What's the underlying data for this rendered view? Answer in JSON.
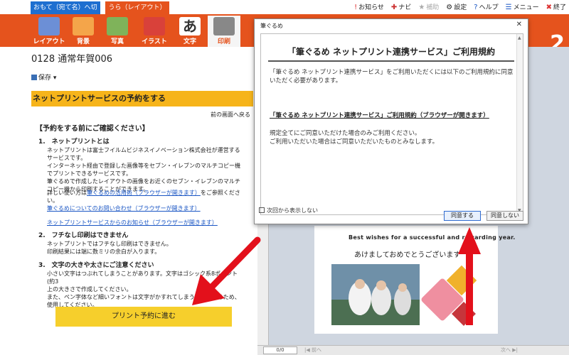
{
  "tabs": {
    "front_label": "おもて（宛て名）へ切替",
    "back_label": "うら（レイアウト）"
  },
  "topmenu": [
    {
      "icon": "!",
      "label": "お知らせ"
    },
    {
      "icon": "✚",
      "label": "ナビ"
    },
    {
      "icon": "★",
      "label": "補助"
    },
    {
      "icon": "⚙",
      "label": "設定"
    },
    {
      "icon": "?",
      "label": "ヘルプ"
    },
    {
      "icon": "☰",
      "label": "メニュー"
    },
    {
      "icon": "✖",
      "label": "終了"
    }
  ],
  "toolbar": {
    "items": [
      {
        "label": "レイアウト",
        "icon": "layout-icon",
        "color": "#6c8fd6"
      },
      {
        "label": "背景",
        "icon": "background-icon",
        "color": "#f4a54a"
      },
      {
        "label": "写真",
        "icon": "photo-icon",
        "color": "#7fb35a"
      },
      {
        "label": "イラスト",
        "icon": "illustration-icon",
        "color": "#d9413a"
      },
      {
        "label": "文字",
        "icon": "text-icon",
        "color": "#333333"
      },
      {
        "label": "印刷",
        "icon": "print-icon",
        "color": "#888888"
      }
    ],
    "big_number": "2"
  },
  "document": {
    "name": "0128 通常年賀006",
    "save_label": "保存"
  },
  "left_panel": {
    "section_title": "ネットプリントサービスの予約をする",
    "back_link": "前の画面へ戻る",
    "confirm_title": "【予約をする前にご確認ください】",
    "item1_title": "1.　ネットプリントとは",
    "item1_body": "ネットプリントは富士フイルムビジネスイノベーション株式会社が運営するサービスです。\nインターネット経由で登録した画像等をセブン・イレブンのマルチコピー機でプリントできるサービスです。\n筆ぐるめで作成したレイアウトの画像をお近くのセブン・イレブンのマルチコピー機から印刷することができます。",
    "item1_detail_prefix": "詳しい使い方は",
    "item1_detail_link": "筆ぐるめの活用術（ブラウザーが開きます）",
    "item1_detail_suffix": "をご参照ください。",
    "link_inquiry": "筆ぐるめについてのお問い合わせ（ブラウザーが開きます）",
    "link_notice": "ネットプリントサービスからのお知らせ（ブラウザーが開きます）",
    "item2_title": "2.　フチなし印刷はできません",
    "item2_body": "ネットプリントではフチなし印刷はできません。\n印刷結果には端に数ミリの余白が入ります。",
    "item3_title": "3.　文字の大きや太さにご注意ください",
    "item3_body": "小さい文字はつぶれてしまうことがあります。文字はゴシック系8ポイント(約3\n上の大きさで作成してください。\nまた、ペン字体など細いフォントは文字がかすれてしまうことがあるため、\n使用してください。",
    "print_button": "プリント予約に進む"
  },
  "preview": {
    "card_english": "Best wishes for a successful and rewarding year.",
    "card_japanese": "あけましておめでとうございます",
    "page_indicator": "0/0",
    "prev_label": "|◀ 前へ",
    "next_label": "次へ ▶|"
  },
  "dialog": {
    "title": "筆ぐるめ",
    "heading": "「筆ぐるめ ネットプリント連携サービス」ご利用規約",
    "intro": "「筆ぐるめ ネットプリント連携サービス」をご利用いただくには以下のご利用規約に同意いただく必要があります。",
    "terms_link": "「筆ぐるめ ネットプリント連携サービス」ご利用規約（ブラウザーが開きます）",
    "notice1": "規定全てにご同意いただけた場合のみご利用ください。",
    "notice2": "ご利用いただいた場合はご同意いただいたものとみなします。",
    "checkbox_label": "次回から表示しない",
    "agree_button": "同意する",
    "disagree_button": "同意しない"
  },
  "colors": {
    "accent_orange": "#e5531d",
    "tab_blue": "#1e6fd0",
    "section_yellow": "#f6b41a",
    "button_yellow": "#f6cf2c",
    "arrow_red": "#e3101b"
  }
}
